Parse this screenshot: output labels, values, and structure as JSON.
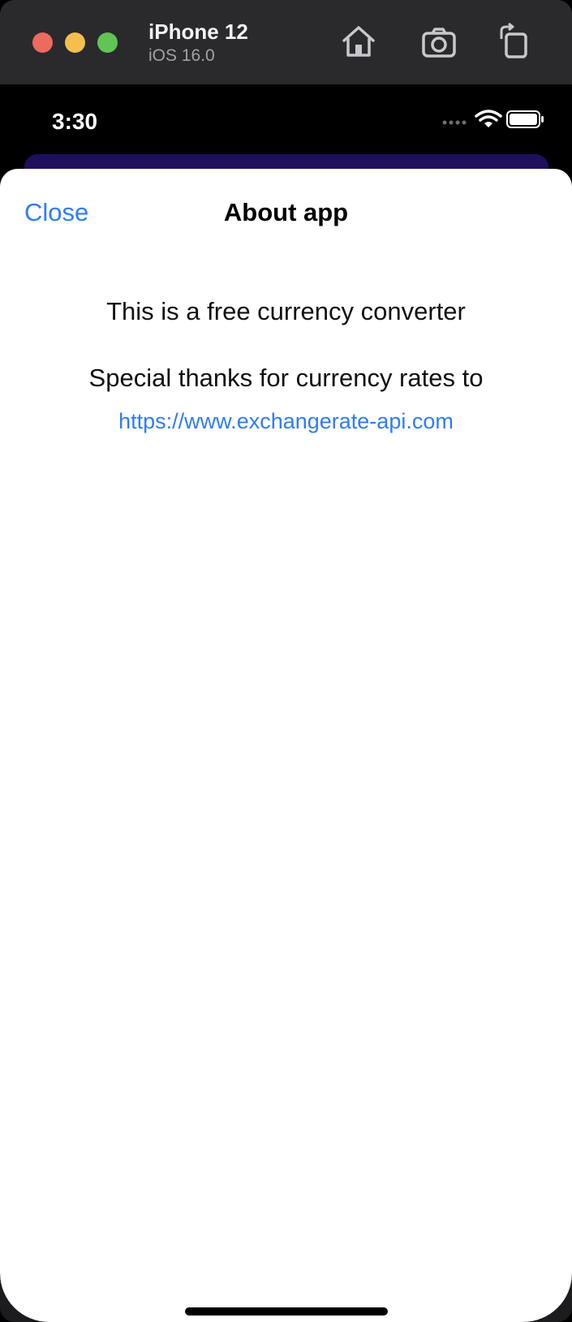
{
  "simulator": {
    "device_name": "iPhone 12",
    "os_version": "iOS 16.0",
    "toolbar_icons": [
      "home-icon",
      "screenshot-icon",
      "rotate-icon"
    ]
  },
  "status_bar": {
    "time": "3:30",
    "icons": [
      "cellular-dots-icon",
      "wifi-icon",
      "battery-icon"
    ]
  },
  "sheet": {
    "close_label": "Close",
    "title": "About app",
    "description": "This is a free currency converter",
    "thanks_text": "Special thanks for currency rates to",
    "link_text": "https://www.exchangerate-api.com"
  },
  "colors": {
    "link_blue": "#2f7cf6",
    "behind_card": "#1f0f5c",
    "traffic_red": "#ed6a5e",
    "traffic_yellow": "#f5bf4f",
    "traffic_green": "#61c454"
  }
}
